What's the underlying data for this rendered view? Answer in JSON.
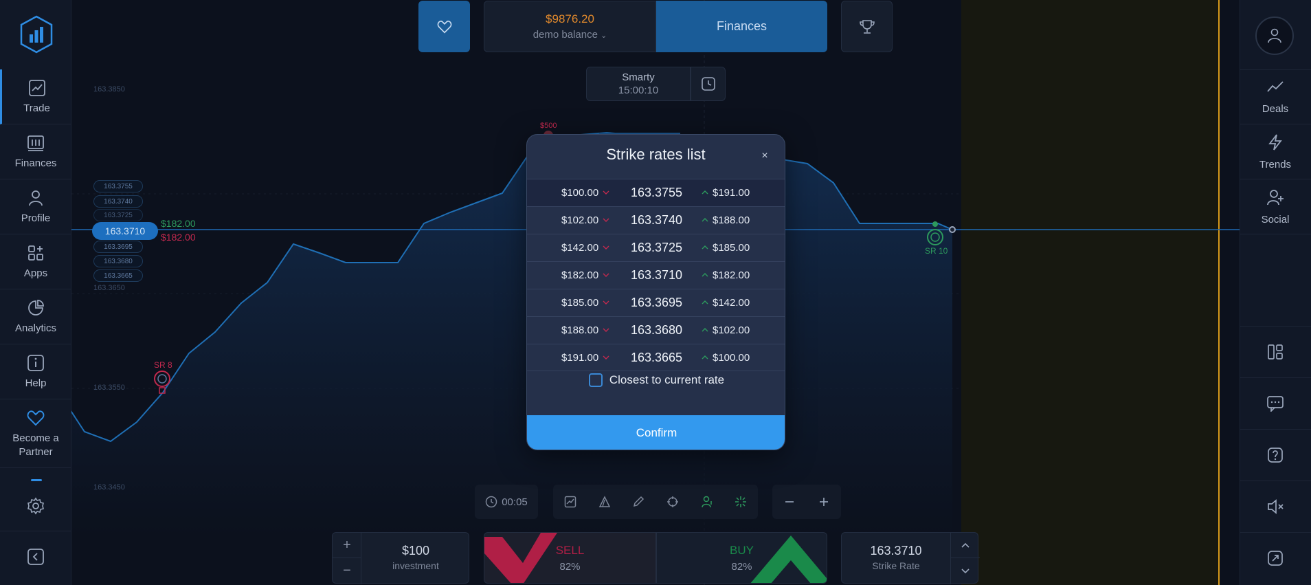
{
  "app": {
    "nav": [
      {
        "key": "trade",
        "label": "Trade"
      },
      {
        "key": "finances",
        "label": "Finances"
      },
      {
        "key": "profile",
        "label": "Profile"
      },
      {
        "key": "apps",
        "label": "Apps"
      },
      {
        "key": "analytics",
        "label": "Analytics"
      },
      {
        "key": "help",
        "label": "Help"
      },
      {
        "key": "partner",
        "label": "Become a Partner"
      }
    ],
    "right_nav": [
      {
        "key": "deals",
        "label": "Deals"
      },
      {
        "key": "trends",
        "label": "Trends"
      },
      {
        "key": "social",
        "label": "Social"
      }
    ]
  },
  "header": {
    "balance_amount": "$9876.20",
    "balance_label": "demo balance",
    "balance_caret": "⌄",
    "finances_label": "Finances"
  },
  "asset": {
    "name": "Smarty",
    "time": "15:00:10"
  },
  "chart": {
    "price_levels": [
      "163.3850",
      "163.3650",
      "163.3550",
      "163.3450"
    ],
    "strike_pills": [
      "163.3755",
      "163.3740",
      "163.3725",
      "163.3695",
      "163.3680",
      "163.3665"
    ],
    "current_rate": "163.3710",
    "side_payout_up": "$182.00",
    "side_payout_down": "$182.00",
    "marker_amount": "$500",
    "sr_left": "SR 8",
    "sr_right": "SR 10",
    "colors": {
      "line": "#1f6fb5",
      "fill": "#11243d",
      "up": "#2d9a5d",
      "down": "#c2294e"
    }
  },
  "toolbar": {
    "timer": "00:05"
  },
  "trade": {
    "investment_value": "$100",
    "investment_label": "investment",
    "plus": "+",
    "minus": "−",
    "sell_label": "SELL",
    "sell_percent": "82%",
    "buy_label": "BUY",
    "buy_percent": "82%",
    "strike_value": "163.3710",
    "strike_label": "Strike Rate"
  },
  "modal": {
    "title": "Strike rates list",
    "close": "×",
    "rows": [
      {
        "down": "$100.00",
        "rate": "163.3755",
        "up": "$191.00"
      },
      {
        "down": "$102.00",
        "rate": "163.3740",
        "up": "$188.00"
      },
      {
        "down": "$142.00",
        "rate": "163.3725",
        "up": "$185.00"
      },
      {
        "down": "$182.00",
        "rate": "163.3710",
        "up": "$182.00"
      },
      {
        "down": "$185.00",
        "rate": "163.3695",
        "up": "$142.00"
      },
      {
        "down": "$188.00",
        "rate": "163.3680",
        "up": "$102.00"
      },
      {
        "down": "$191.00",
        "rate": "163.3665",
        "up": "$100.00"
      }
    ],
    "checkbox_label": "Closest to current rate",
    "confirm_label": "Confirm"
  }
}
